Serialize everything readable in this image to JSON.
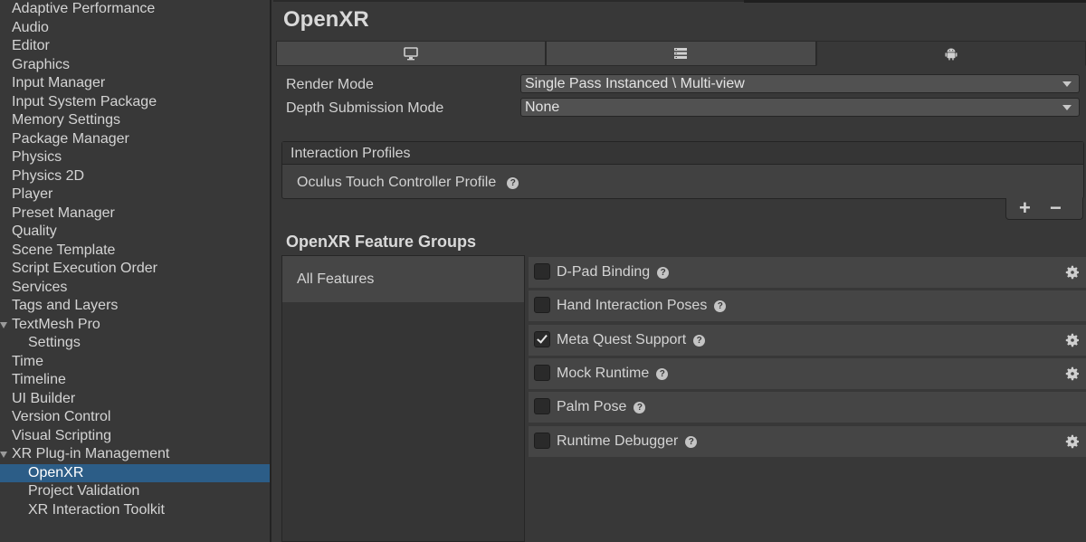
{
  "sidebar": {
    "items": [
      {
        "label": "Adaptive Performance",
        "child": false
      },
      {
        "label": "Audio",
        "child": false
      },
      {
        "label": "Editor",
        "child": false
      },
      {
        "label": "Graphics",
        "child": false
      },
      {
        "label": "Input Manager",
        "child": false
      },
      {
        "label": "Input System Package",
        "child": false
      },
      {
        "label": "Memory Settings",
        "child": false
      },
      {
        "label": "Package Manager",
        "child": false
      },
      {
        "label": "Physics",
        "child": false
      },
      {
        "label": "Physics 2D",
        "child": false
      },
      {
        "label": "Player",
        "child": false
      },
      {
        "label": "Preset Manager",
        "child": false
      },
      {
        "label": "Quality",
        "child": false
      },
      {
        "label": "Scene Template",
        "child": false
      },
      {
        "label": "Script Execution Order",
        "child": false
      },
      {
        "label": "Services",
        "child": false
      },
      {
        "label": "Tags and Layers",
        "child": false
      },
      {
        "label": "TextMesh Pro",
        "child": false,
        "expanded": true
      },
      {
        "label": "Settings",
        "child": true
      },
      {
        "label": "Time",
        "child": false
      },
      {
        "label": "Timeline",
        "child": false
      },
      {
        "label": "UI Builder",
        "child": false
      },
      {
        "label": "Version Control",
        "child": false
      },
      {
        "label": "Visual Scripting",
        "child": false
      },
      {
        "label": "XR Plug-in Management",
        "child": false,
        "expanded": true
      },
      {
        "label": "OpenXR",
        "child": true,
        "selected": true
      },
      {
        "label": "Project Validation",
        "child": true
      },
      {
        "label": "XR Interaction Toolkit",
        "child": true
      }
    ],
    "selected_color": "#2c5d87"
  },
  "main": {
    "title": "OpenXR",
    "tabs": [
      {
        "icon": "monitor-icon",
        "active": false
      },
      {
        "icon": "server-icon",
        "active": false
      },
      {
        "icon": "android-icon",
        "active": true
      }
    ],
    "render_mode": {
      "label": "Render Mode",
      "value": "Single Pass Instanced \\ Multi-view"
    },
    "depth_mode": {
      "label": "Depth Submission Mode",
      "value": "None"
    },
    "interaction_profiles": {
      "header": "Interaction Profiles",
      "items": [
        "Oculus Touch Controller Profile"
      ],
      "add": "+",
      "remove": "−"
    },
    "feature_groups": {
      "title": "OpenXR Feature Groups",
      "groups": [
        "All Features"
      ],
      "features": [
        {
          "label": "D-Pad Binding",
          "checked": false,
          "settings": true
        },
        {
          "label": "Hand Interaction Poses",
          "checked": false,
          "settings": false
        },
        {
          "label": "Meta Quest Support",
          "checked": true,
          "settings": true
        },
        {
          "label": "Mock Runtime",
          "checked": false,
          "settings": true
        },
        {
          "label": "Palm Pose",
          "checked": false,
          "settings": false
        },
        {
          "label": "Runtime Debugger",
          "checked": false,
          "settings": true
        }
      ]
    }
  }
}
